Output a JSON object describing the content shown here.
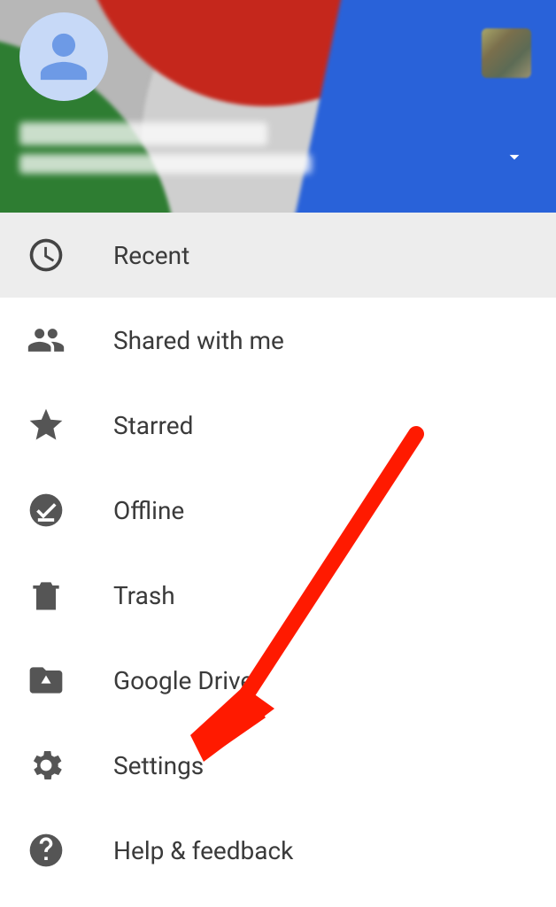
{
  "header": {
    "user_name": "",
    "user_email": ""
  },
  "menu": {
    "recent": "Recent",
    "shared": "Shared with me",
    "starred": "Starred",
    "offline": "Offline",
    "trash": "Trash",
    "drive": "Google Drive",
    "settings": "Settings",
    "help": "Help & feedback"
  },
  "annotation": {
    "arrow_target": "settings"
  }
}
